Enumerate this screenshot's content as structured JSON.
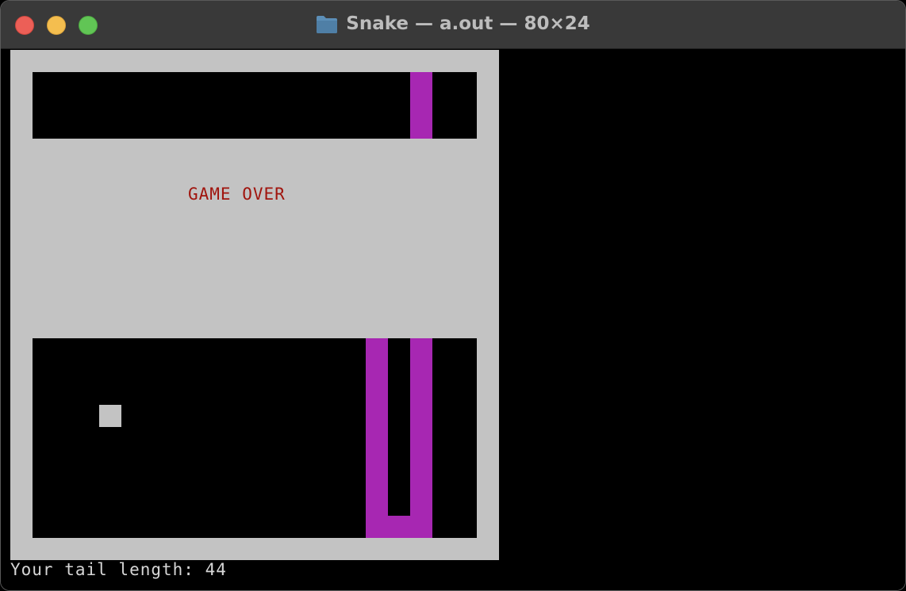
{
  "window": {
    "title": "Snake — a.out — 80×24",
    "icon": "folder-icon",
    "controls": [
      "close-button",
      "minimize-button",
      "zoom-button"
    ]
  },
  "game": {
    "message": "GAME OVER",
    "status": "Your tail length: 44",
    "colors": {
      "board": "#c3c3c3",
      "pit": "#000000",
      "snake": "#a727b2",
      "message": "#a0140d",
      "terminal_background": "#000000",
      "status_text": "#d6d6d6"
    }
  }
}
